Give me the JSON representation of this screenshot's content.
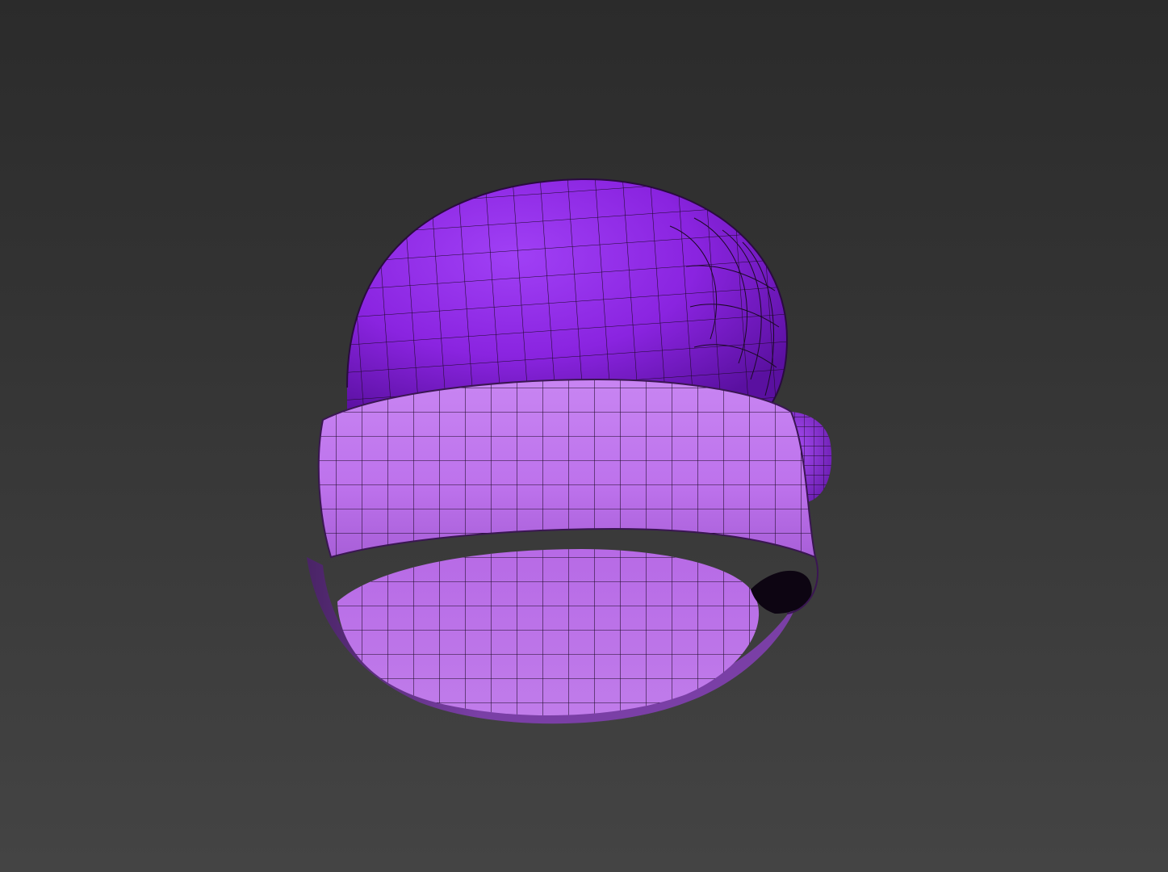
{
  "viewport": {
    "background_top": "#2b2b2b",
    "background_bottom": "#444444"
  },
  "model": {
    "crown_color": "#8a24e0",
    "crown_shadow": "#5a10a0",
    "cuff_color": "#c47bee",
    "cuff_shadow": "#7a3fa6",
    "wire_color": "#1a0a24",
    "shading": "wireframe-on-shaded"
  }
}
